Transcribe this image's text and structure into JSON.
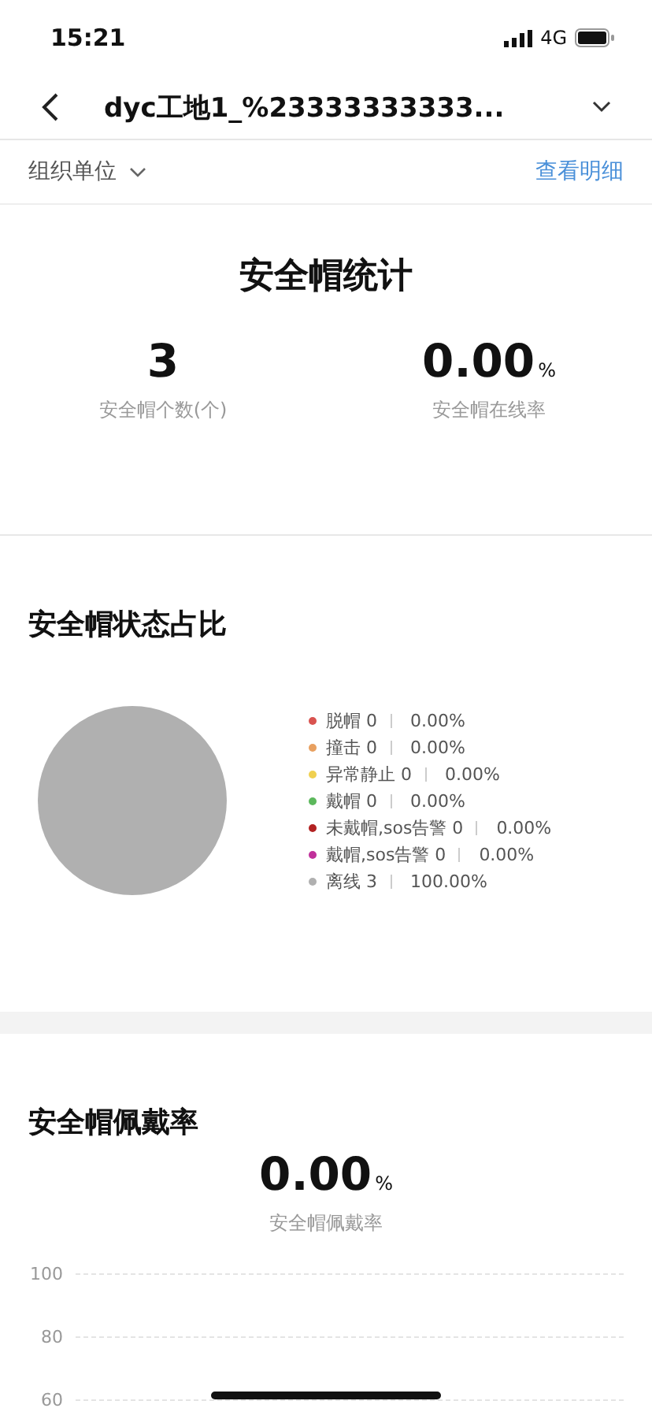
{
  "status_bar": {
    "time": "15:21",
    "network": "4G"
  },
  "nav": {
    "title": "dyc工地1_%23333333333..."
  },
  "filter": {
    "label": "组织单位",
    "link": "查看明细"
  },
  "stats": {
    "title": "安全帽统计",
    "metrics": [
      {
        "value": "3",
        "label": "安全帽个数(个)"
      },
      {
        "value": "0.00",
        "unit": "%",
        "label": "安全帽在线率"
      }
    ]
  },
  "status_share": {
    "title": "安全帽状态占比",
    "legend": [
      {
        "label": "脱帽 0",
        "percent": "0.00%",
        "color": "#d9534f"
      },
      {
        "label": "撞击 0",
        "percent": "0.00%",
        "color": "#e8a060"
      },
      {
        "label": "异常静止 0",
        "percent": "0.00%",
        "color": "#f0d050"
      },
      {
        "label": "戴帽 0",
        "percent": "0.00%",
        "color": "#5cb85c"
      },
      {
        "label": "未戴帽,sos告警 0",
        "percent": "0.00%",
        "color": "#b22222"
      },
      {
        "label": "戴帽,sos告警 0",
        "percent": "0.00%",
        "color": "#c0309a"
      },
      {
        "label": "离线 3",
        "percent": "100.00%",
        "color": "#b0b0b0"
      }
    ],
    "chart_data": {
      "type": "pie",
      "values": [
        0,
        0,
        0,
        0,
        0,
        0,
        100
      ]
    }
  },
  "wear_rate": {
    "title": "安全帽佩戴率",
    "value": "0.00",
    "unit": "%",
    "label": "安全帽佩戴率",
    "y_labels": [
      "100",
      "80",
      "60"
    ]
  }
}
